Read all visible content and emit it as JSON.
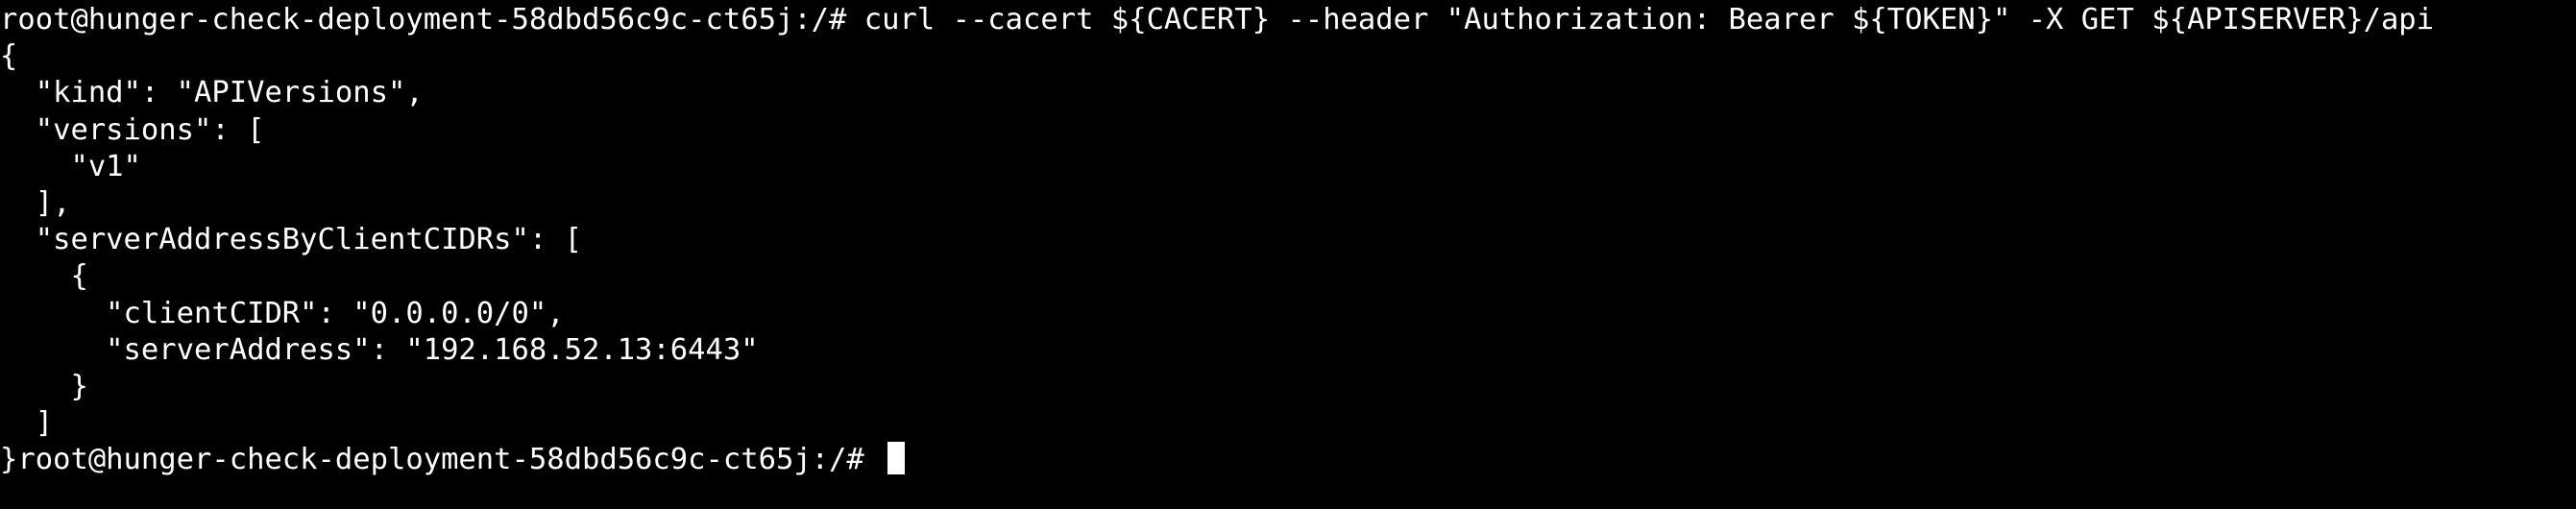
{
  "terminal": {
    "colors": {
      "background": "#000000",
      "foreground": "#ffffff",
      "cursor": "#ffffff"
    },
    "lines": [
      "root@hunger-check-deployment-58dbd56c9c-ct65j:/# curl --cacert ${CACERT} --header \"Authorization: Bearer ${TOKEN}\" -X GET ${APISERVER}/api",
      "{",
      "  \"kind\": \"APIVersions\",",
      "  \"versions\": [",
      "    \"v1\"",
      "  ],",
      "  \"serverAddressByClientCIDRs\": [",
      "    {",
      "      \"clientCIDR\": \"0.0.0.0/0\",",
      "      \"serverAddress\": \"192.168.52.13:6443\"",
      "    }",
      "  ]"
    ],
    "prompt_line": "}root@hunger-check-deployment-58dbd56c9c-ct65j:/# "
  }
}
